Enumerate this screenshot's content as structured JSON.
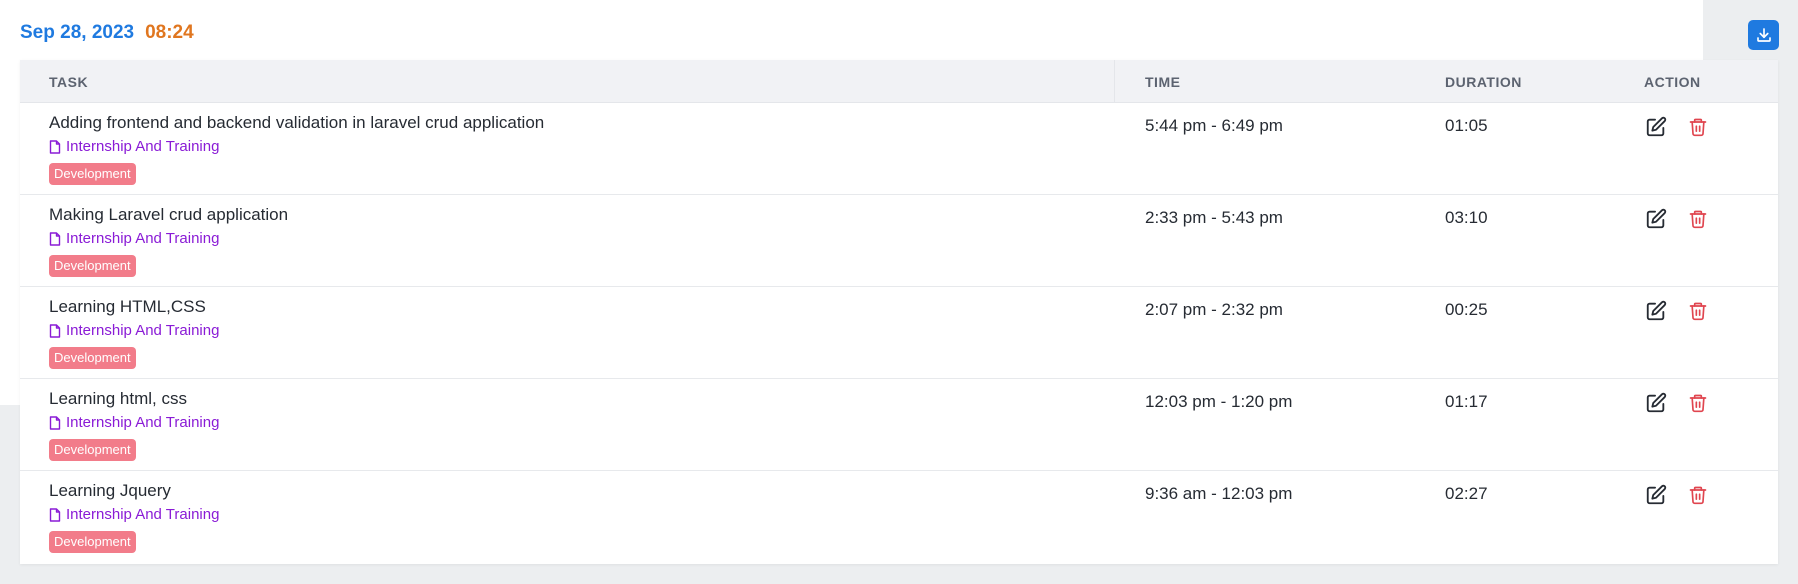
{
  "header": {
    "date": "Sep 28, 2023",
    "time": "08:24",
    "download_icon": "download-icon"
  },
  "table": {
    "columns": {
      "task": "TASK",
      "time": "TIME",
      "duration": "DURATION",
      "action": "ACTION"
    },
    "rows": [
      {
        "title": "Adding frontend and backend validation in laravel crud application",
        "project": "Internship And Training",
        "tag": "Development",
        "time": "5:44 pm - 6:49 pm",
        "duration": "01:05"
      },
      {
        "title": "Making Laravel crud application",
        "project": "Internship And Training",
        "tag": "Development",
        "time": "2:33 pm - 5:43 pm",
        "duration": "03:10"
      },
      {
        "title": "Learning HTML,CSS",
        "project": "Internship And Training",
        "tag": "Development",
        "time": "2:07 pm - 2:32 pm",
        "duration": "00:25"
      },
      {
        "title": "Learning html, css",
        "project": "Internship And Training",
        "tag": "Development",
        "time": "12:03 pm - 1:20 pm",
        "duration": "01:17"
      },
      {
        "title": "Learning Jquery",
        "project": "Internship And Training",
        "tag": "Development",
        "time": "9:36 am - 12:03 pm",
        "duration": "02:27"
      }
    ]
  },
  "colors": {
    "date": "#1f7ae0",
    "time": "#e0761f",
    "project": "#8a1bd6",
    "tag_bg": "#f27c8a",
    "delete": "#e0454f"
  }
}
